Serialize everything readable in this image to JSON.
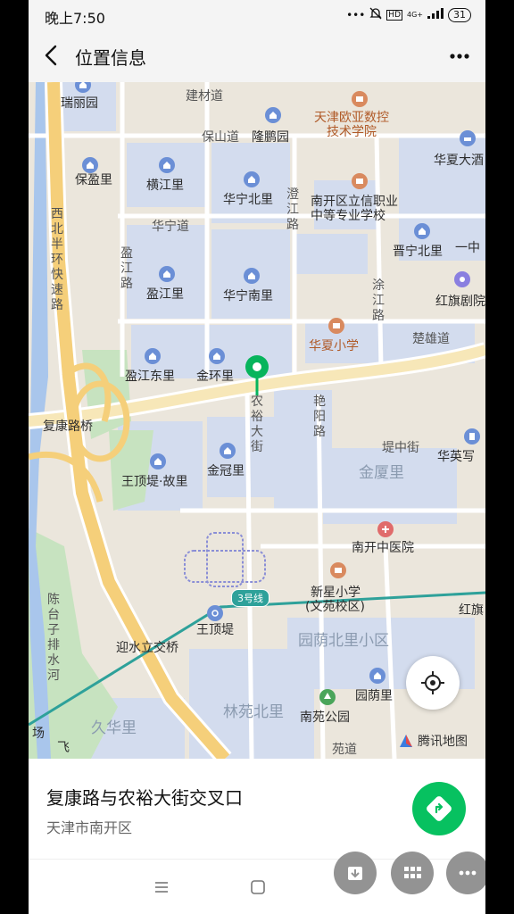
{
  "status": {
    "time": "晚上7:50",
    "network": "4G+",
    "battery": "31"
  },
  "appbar": {
    "title": "位置信息"
  },
  "map": {
    "labels": {
      "ruiliyuan": "瑞丽园",
      "jincai": "建材道",
      "baoshan": "保山道",
      "longpeng": "隆鹏园",
      "tianjin_eu": "天津欧亚数控",
      "tianjin_eu2": "技术学院",
      "huaxia_hotel": "华夏大酒",
      "baoying": "保盈里",
      "hengjiang": "横江里",
      "huaning_n": "华宁北里",
      "chengjiang": "澄江路",
      "nankai_vocational": "南开区立信职业",
      "nankai_vocational2": "中等专业学校",
      "xibei": "西北半环快速路",
      "huaning_dao": "华宁道",
      "jinning_n": "晋宁北里",
      "yizhong": "一中",
      "yingjiang_lu": "盈江路",
      "yingjiang_li": "盈江里",
      "huaning_s": "华宁南里",
      "tujiang": "涂江路",
      "hongqi": "红旗剧院",
      "huaxia_school": "华夏小学",
      "chuxiong": "楚雄道",
      "yingjiang_e": "盈江东里",
      "jinhuan": "金环里",
      "nongyu": "农裕大街",
      "yanyang": "艳阳路",
      "fukang_bridge": "复康路桥",
      "dizhong": "堤中街",
      "huaying": "华英写",
      "wangdingdi_gu": "王顶堤·故里",
      "jinguan": "金冠里",
      "jinxia": "金厦里",
      "nankai_hospital": "南开中医院",
      "xinxing": "新星小学",
      "xinxing2": "(文苑校区)",
      "hongqi2": "红旗",
      "chentaizi": "陈台子排水河",
      "wangdingdi": "王顶堤",
      "yingshui": "迎水立交桥",
      "yuanyin_n": "园荫北里小区",
      "yuanyin": "园荫里",
      "linyuan_n": "林苑北里",
      "nanyuan_park": "南苑公园",
      "jiuhua": "久华里",
      "chang": "场",
      "fei": "飞",
      "yuanzdao": "苑道"
    },
    "line3_label": "3号线",
    "provider": "腾讯地图"
  },
  "place": {
    "name": "复康路与农裕大街交叉口",
    "address": "天津市南开区"
  },
  "colors": {
    "accent_green": "#07c160",
    "map_bg": "#ebe6dc",
    "block_blue": "#d2dcef",
    "metro": "#2ea19a"
  }
}
